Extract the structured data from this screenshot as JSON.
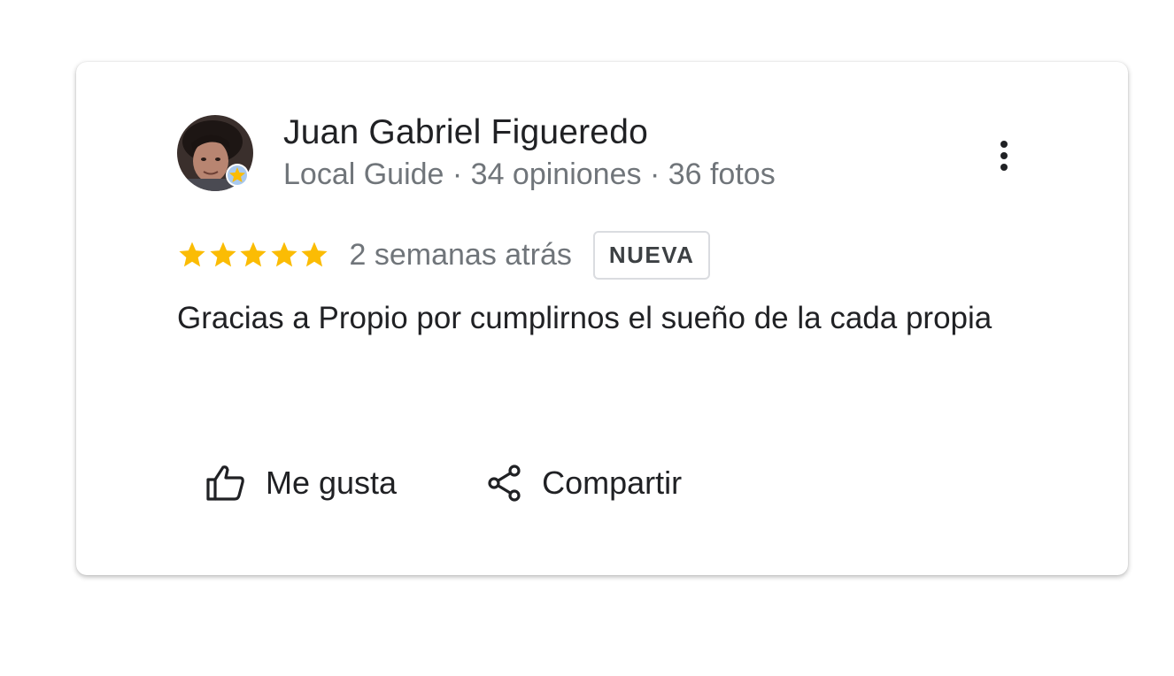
{
  "review": {
    "author": "Juan Gabriel Figueredo",
    "meta": "Local Guide · 34 opiniones · 36 fotos",
    "rating": 5,
    "rating_max": 5,
    "date": "2 semanas atrás",
    "badge": "NUEVA",
    "text": "Gracias a Propio por cumplirnos el sueño de la cada propia"
  },
  "actions": {
    "like_label": "Me gusta",
    "share_label": "Compartir"
  },
  "icons": {
    "more": "more-vert-icon",
    "like": "thumb-up-icon",
    "share": "share-icon",
    "star": "star-icon",
    "local_guide": "local-guide-badge-icon"
  },
  "colors": {
    "star": "#fbbc04",
    "text_primary": "#202124",
    "text_secondary": "#70757a",
    "badge_border": "#dadce0"
  }
}
